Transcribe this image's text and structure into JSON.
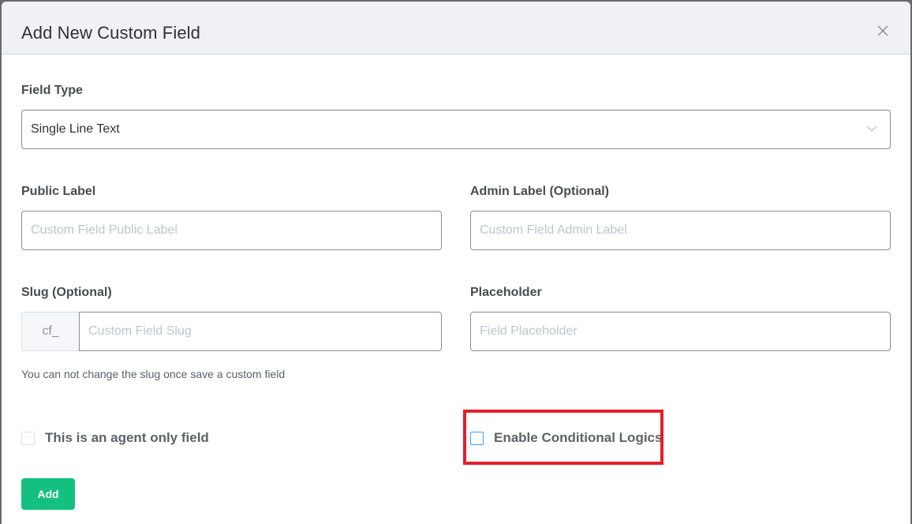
{
  "modal": {
    "title": "Add New Custom Field",
    "close_icon": "close-icon"
  },
  "form": {
    "field_type": {
      "label": "Field Type",
      "selected": "Single Line Text",
      "icon": "chevron-down-icon"
    },
    "public_label": {
      "label": "Public Label",
      "value": "",
      "placeholder": "Custom Field Public Label"
    },
    "admin_label": {
      "label": "Admin Label (Optional)",
      "value": "",
      "placeholder": "Custom Field Admin Label"
    },
    "slug": {
      "label": "Slug (Optional)",
      "prefix": "cf_",
      "value": "",
      "placeholder": "Custom Field Slug",
      "help": "You can not change the slug once save a custom field"
    },
    "placeholder_field": {
      "label": "Placeholder",
      "value": "",
      "placeholder": "Field Placeholder"
    },
    "agent_only": {
      "label": "This is an agent only field",
      "checked": false
    },
    "conditional_logics": {
      "label": "Enable Conditional Logics",
      "checked": false,
      "highlighted": true
    },
    "submit_label": "Add"
  },
  "colors": {
    "primary": "#13c07f",
    "highlight": "#e41e2b",
    "focus": "#409eff"
  }
}
